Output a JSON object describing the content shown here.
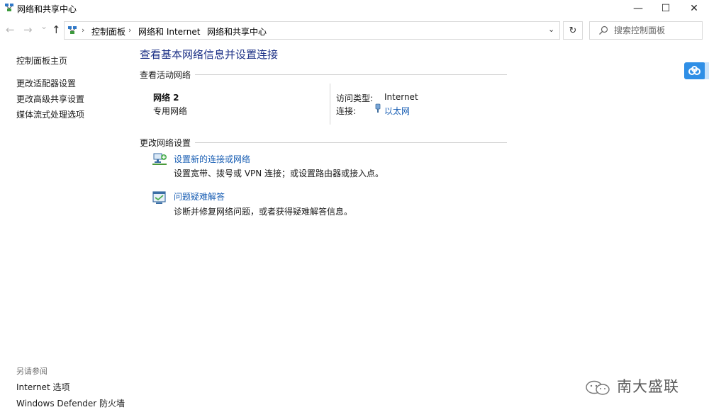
{
  "window": {
    "title": "网络和共享中心",
    "app_icon": "network-icon"
  },
  "window_controls": {
    "minimize": "—",
    "maximize": "☐",
    "close": "✕"
  },
  "nav": {
    "back": "←",
    "forward": "→",
    "recent": "⌄",
    "up": "↑"
  },
  "address_bar": {
    "icon": "network-icon",
    "breadcrumbs": [
      "控制面板",
      "网络和 Internet",
      "网络和共享中心"
    ],
    "separator": "›",
    "dropdown": "⌄"
  },
  "refresh": {
    "glyph": "↻"
  },
  "search": {
    "placeholder": "搜索控制面板"
  },
  "sidebar": {
    "home": "控制面板主页",
    "links": [
      "更改适配器设置",
      "更改高级共享设置",
      "媒体流式处理选项"
    ],
    "see_also_title": "另请参阅",
    "see_also_links": [
      "Internet 选项",
      "Windows Defender 防火墙"
    ]
  },
  "main": {
    "title": "查看基本网络信息并设置连接",
    "active_networks_header": "查看活动网络",
    "network": {
      "name": "网络  2",
      "type": "专用网络",
      "access_type_label": "访问类型:",
      "access_type_value": "Internet",
      "connections_label": "连接:",
      "connections_value": "以太网"
    },
    "change_settings_header": "更改网络设置",
    "tasks": [
      {
        "icon": "new-connection-icon",
        "link": "设置新的连接或网络",
        "desc": "设置宽带、拨号或 VPN 连接；或设置路由器或接入点。"
      },
      {
        "icon": "troubleshoot-icon",
        "link": "问题疑难解答",
        "desc": "诊断并修复网络问题，或者获得疑难解答信息。"
      }
    ]
  },
  "overlay": {
    "cloud_button_icon": "cloud-icon"
  },
  "watermark": {
    "text": "南大盛联",
    "icon": "wechat-icon"
  },
  "colors": {
    "link": "#1a5fb4",
    "title": "#1e3287",
    "accent": "#2f8fe6"
  }
}
